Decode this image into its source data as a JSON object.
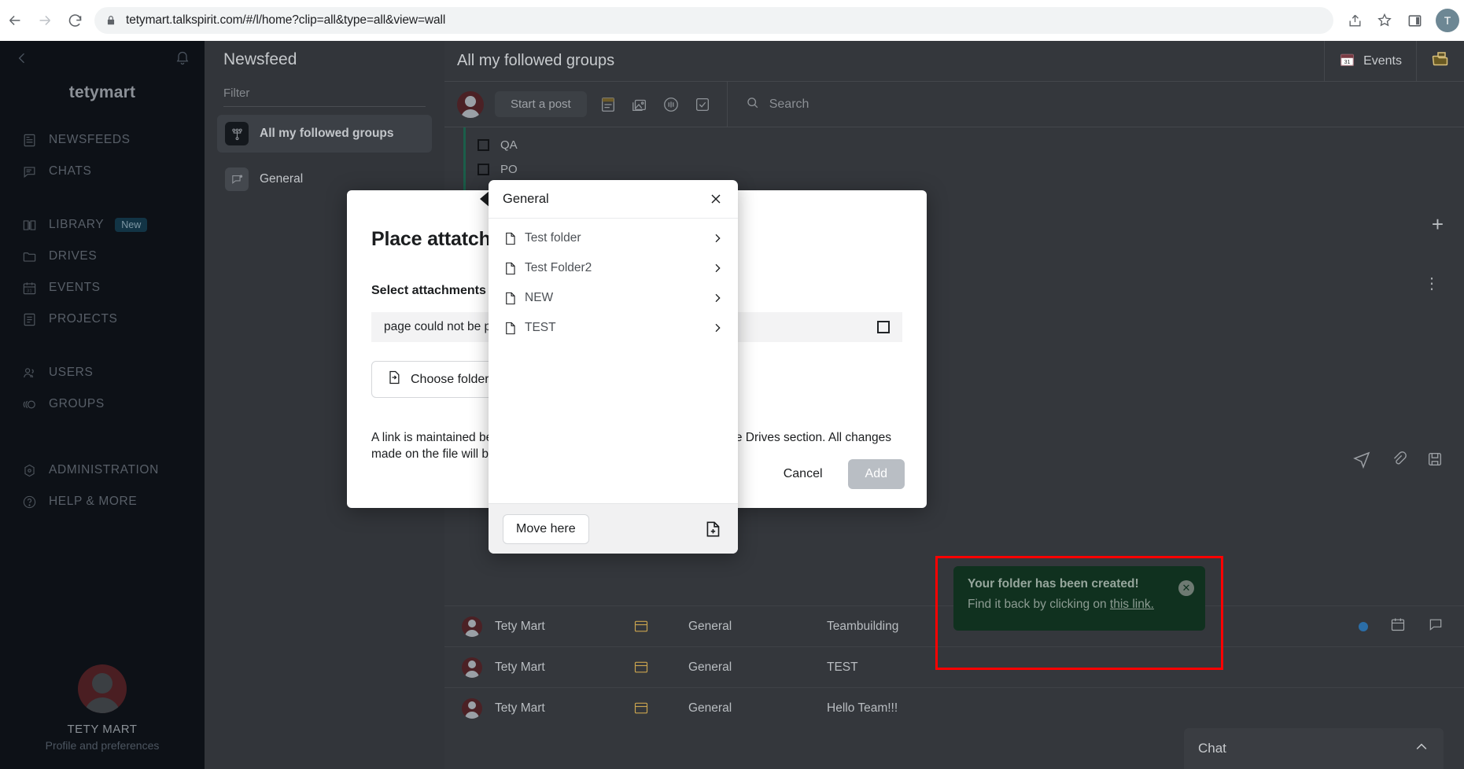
{
  "browser": {
    "back_icon": "back-arrow-icon",
    "forward_icon": "forward-arrow-icon",
    "reload_icon": "reload-icon",
    "lock_icon": "lock-icon",
    "url": "tetymart.talkspirit.com/#/l/home?clip=all&type=all&view=wall",
    "share_icon": "share-icon",
    "bookmark_icon": "star-icon",
    "sidepanel_icon": "side-panel-icon",
    "profile_initial": "T"
  },
  "rail": {
    "back_label": "collapse-sidebar",
    "brand": "tetymart",
    "groups": [
      {
        "items": [
          {
            "label": "NEWSFEEDS",
            "icon": "newsfeed-icon"
          },
          {
            "label": "CHATS",
            "icon": "chat-icon"
          }
        ]
      },
      {
        "items": [
          {
            "label": "LIBRARY",
            "icon": "library-icon",
            "badge": "New"
          },
          {
            "label": "DRIVES",
            "icon": "drive-icon"
          },
          {
            "label": "EVENTS",
            "icon": "calendar-icon"
          },
          {
            "label": "PROJECTS",
            "icon": "projects-icon"
          }
        ]
      },
      {
        "items": [
          {
            "label": "USERS",
            "icon": "users-icon"
          },
          {
            "label": "GROUPS",
            "icon": "groups-icon"
          }
        ]
      },
      {
        "items": [
          {
            "label": "ADMINISTRATION",
            "icon": "gear-icon"
          },
          {
            "label": "HELP & MORE",
            "icon": "help-icon"
          }
        ]
      }
    ],
    "profile": {
      "name": "TETY MART",
      "subtitle": "Profile and preferences"
    }
  },
  "feed": {
    "title": "Newsfeed",
    "filter_placeholder": "Filter",
    "items": [
      {
        "label": "All my followed groups",
        "icon": "network-icon",
        "active": true
      },
      {
        "label": "General",
        "icon": "group-icon",
        "active": false
      }
    ]
  },
  "main": {
    "title": "All my followed groups",
    "events_label": "Events",
    "events_icon": "calendar-31-icon",
    "drive_icon": "folder-icon",
    "composer": {
      "start_post": "Start a post",
      "icons": [
        "article-icon",
        "image-icon",
        "poll-icon",
        "task-icon"
      ]
    },
    "search_placeholder": "Search",
    "checklines": [
      "QA",
      "PO"
    ],
    "posts": [
      {
        "author": "Tety Mart",
        "group": "General",
        "title": "Teambuilding"
      },
      {
        "author": "Tety Mart",
        "group": "General",
        "title": "TEST"
      },
      {
        "author": "Tety Mart",
        "group": "General",
        "title": "Hello Team!!!"
      }
    ],
    "chat_label": "Chat"
  },
  "attach_modal": {
    "title": "Place attatchment",
    "subtitle": "Select attachments y",
    "field_value": "page could not be p",
    "choose_folder_label": "Choose folder",
    "choose_folder_icon": "move-to-folder-icon",
    "note_line1_left": "A link is maintained be",
    "note_line1_right": "he Drives section. All changes",
    "note_line2": "made on the file will b",
    "cancel_label": "Cancel",
    "add_label": "Add"
  },
  "picker_modal": {
    "title": "General",
    "close_icon": "close-icon",
    "folders": [
      {
        "name": "Test folder",
        "icon": "folder-icon",
        "chevron": "chevron-right-icon"
      },
      {
        "name": "Test Folder2",
        "icon": "folder-icon",
        "chevron": "chevron-right-icon"
      },
      {
        "name": "NEW",
        "icon": "folder-icon",
        "chevron": "chevron-right-icon"
      },
      {
        "name": "TEST",
        "icon": "folder-icon",
        "chevron": "chevron-right-icon"
      }
    ],
    "move_here_label": "Move here",
    "new_folder_icon": "new-folder-icon"
  },
  "toast": {
    "title": "Your folder has been created!",
    "body_prefix": "Find it back by clicking on ",
    "link_text": "this link.",
    "close_icon": "close-icon",
    "highlight_color": "#ff0000",
    "background": "#10311f"
  }
}
